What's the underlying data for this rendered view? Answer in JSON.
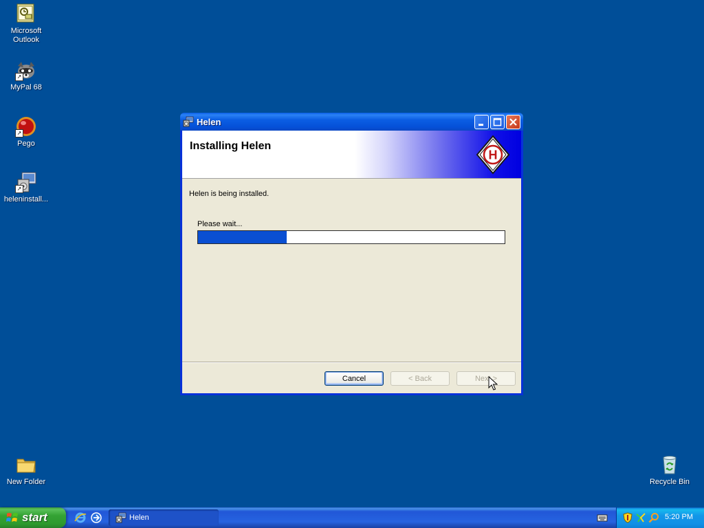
{
  "desktop": {
    "icons": [
      {
        "label": "Microsoft Outlook",
        "icon": "outlook-icon"
      },
      {
        "label": "MyPal 68",
        "icon": "mypal-icon"
      },
      {
        "label": "Pego",
        "icon": "pego-icon"
      },
      {
        "label": "heleninstall...",
        "icon": "installer-icon"
      },
      {
        "label": "New Folder",
        "icon": "folder-icon"
      },
      {
        "label": "Recycle Bin",
        "icon": "recycle-bin-icon"
      }
    ]
  },
  "window": {
    "title": "Helen",
    "banner_title": "Installing Helen",
    "logo_letter": "H",
    "status": "Helen is being installed.",
    "wait_label": "Please wait...",
    "progress": 0.29,
    "buttons": {
      "cancel": "Cancel",
      "back": "< Back",
      "next": "Next >"
    }
  },
  "taskbar": {
    "start_label": "start",
    "task_label": "Helen",
    "clock": "5:20 PM"
  },
  "colors": {
    "desktop": "#004e98",
    "progress_fill": "#0a4fd2",
    "titlebar": "#0550d8"
  }
}
